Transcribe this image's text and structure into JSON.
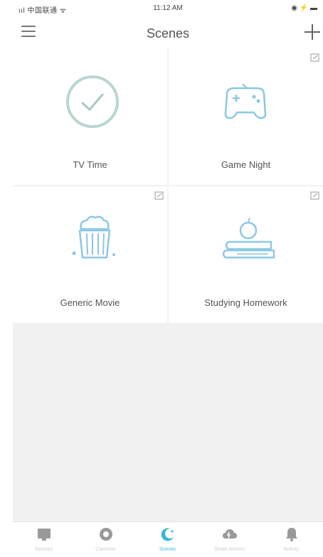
{
  "status_bar": {
    "carrier": "ııl 中国联通 ᯤ",
    "time": "11:12 AM",
    "battery": "◉ ⚡ ▬"
  },
  "nav": {
    "title": "Scenes",
    "menu_icon": "hamburger-menu-icon",
    "add_icon": "plus-icon"
  },
  "scenes": [
    {
      "label": "TV Time",
      "icon": "checkmark-circle-icon",
      "editable": false
    },
    {
      "label": "Game Night",
      "icon": "gamepad-icon",
      "editable": true
    },
    {
      "label": "Generic Movie",
      "icon": "popcorn-icon",
      "editable": true
    },
    {
      "label": "Studying Homework",
      "icon": "apple-books-icon",
      "editable": true
    }
  ],
  "tabs": [
    {
      "label": "Devices",
      "icon": "devices-icon",
      "active": false
    },
    {
      "label": "Cameras",
      "icon": "camera-icon",
      "active": false
    },
    {
      "label": "Scenes",
      "icon": "scenes-moon-icon",
      "active": true
    },
    {
      "label": "Smart Actions",
      "icon": "cloud-smart-actions-icon",
      "active": false
    },
    {
      "label": "Activity",
      "icon": "bell-icon",
      "active": false
    }
  ],
  "colors": {
    "accent": "#38b8d4",
    "icon_line": "#8cc8e4",
    "check_circle": "#b8d6d2",
    "background": "#f1f1f1"
  }
}
